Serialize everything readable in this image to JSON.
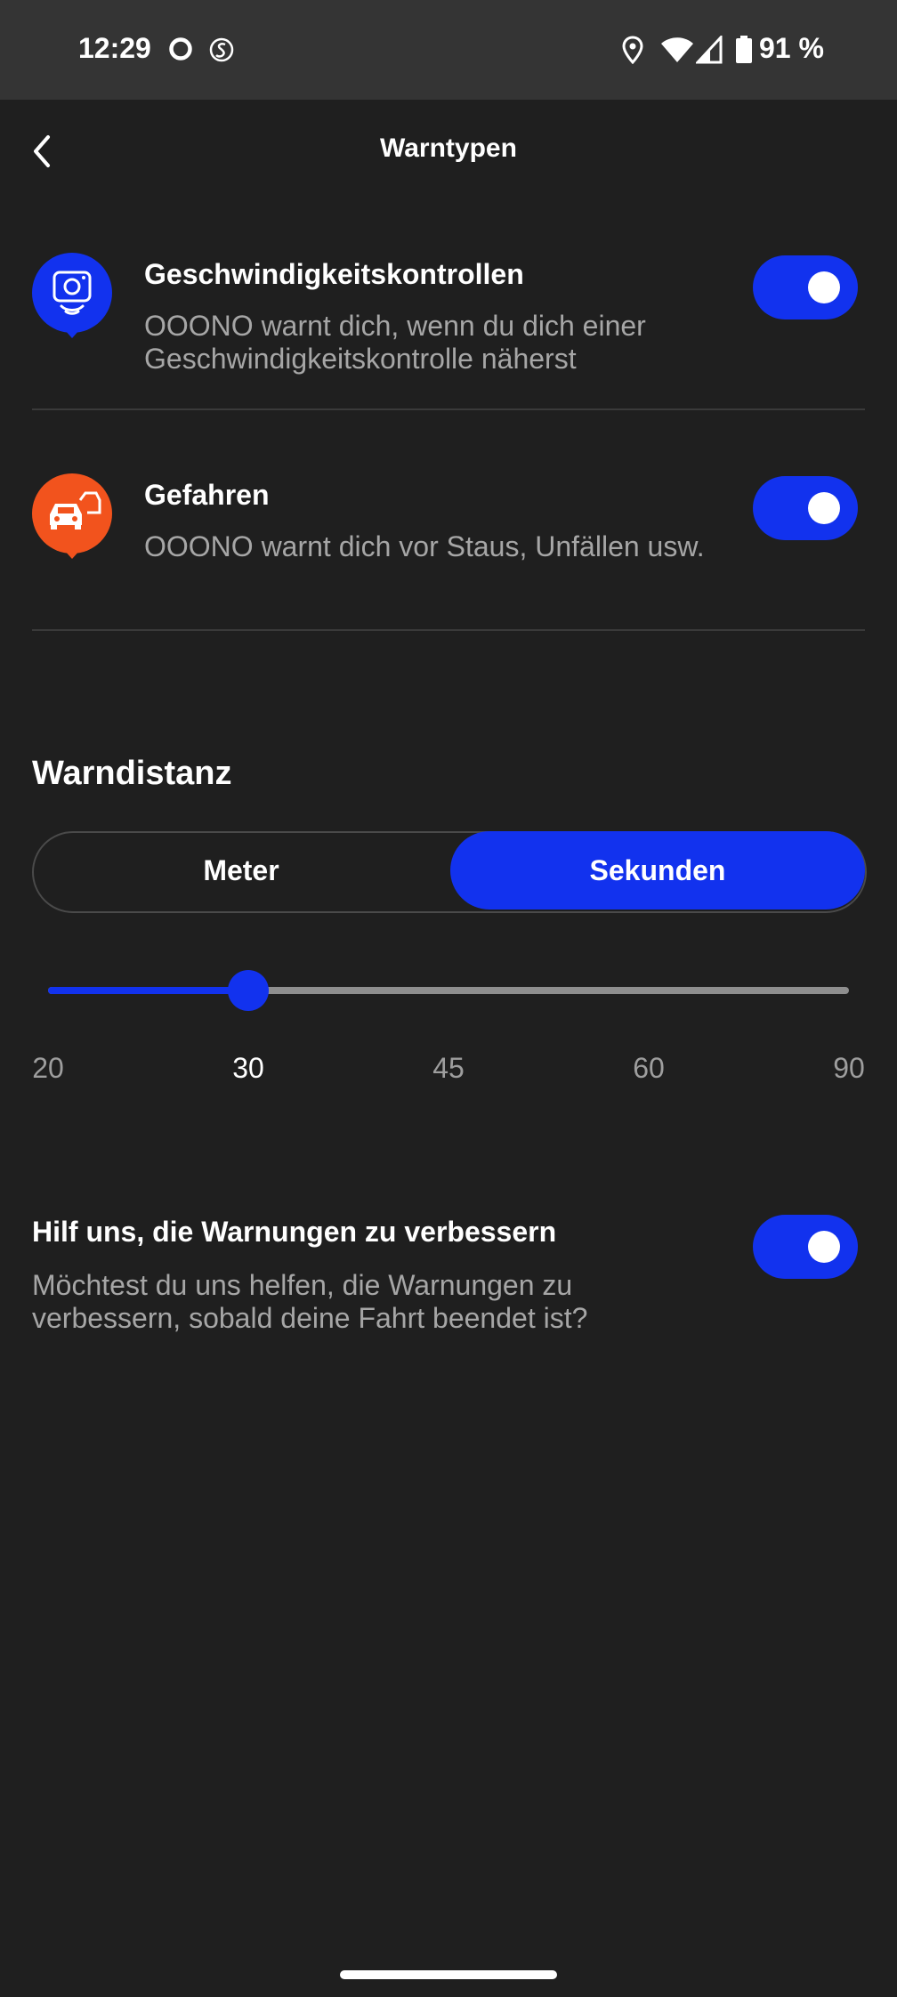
{
  "status_bar": {
    "time": "12:29",
    "battery_text": "91 %",
    "icons": [
      "circle-notification-icon",
      "shazam-notification-icon",
      "location-icon",
      "wifi-icon",
      "cell-signal-icon",
      "battery-icon"
    ]
  },
  "app_bar": {
    "title": "Warntypen",
    "back_icon": "chevron-left-icon"
  },
  "alert_types": [
    {
      "title": "Geschwindigkeitskontrollen",
      "description": "OOONO warnt dich, wenn du dich einer Geschwindigkeitskontrolle näherst",
      "icon": "speed-camera-icon",
      "icon_color": "#1232ee",
      "enabled": true
    },
    {
      "title": "Gefahren",
      "description": "OOONO warnt dich vor Staus, Unfällen usw.",
      "icon": "car-accident-icon",
      "icon_color": "#f2531d",
      "enabled": true
    }
  ],
  "warning_distance": {
    "title": "Warndistanz",
    "units": [
      {
        "label": "Meter",
        "selected": false
      },
      {
        "label": "Sekunden",
        "selected": true
      }
    ],
    "slider": {
      "ticks": [
        "20",
        "30",
        "45",
        "60",
        "90"
      ],
      "selected_index": 1,
      "selected_value": "30"
    }
  },
  "help": {
    "title": "Hilf uns, die Warnungen zu verbessern",
    "description": "Möchtest du uns helfen, die Warnungen zu verbessern, sobald deine Fahrt beendet ist?",
    "enabled": true
  },
  "colors": {
    "accent": "#1232ee",
    "background": "#1f1f1f",
    "status_bar": "#343434",
    "secondary_text": "#a6a6a6",
    "danger": "#f2531d"
  }
}
